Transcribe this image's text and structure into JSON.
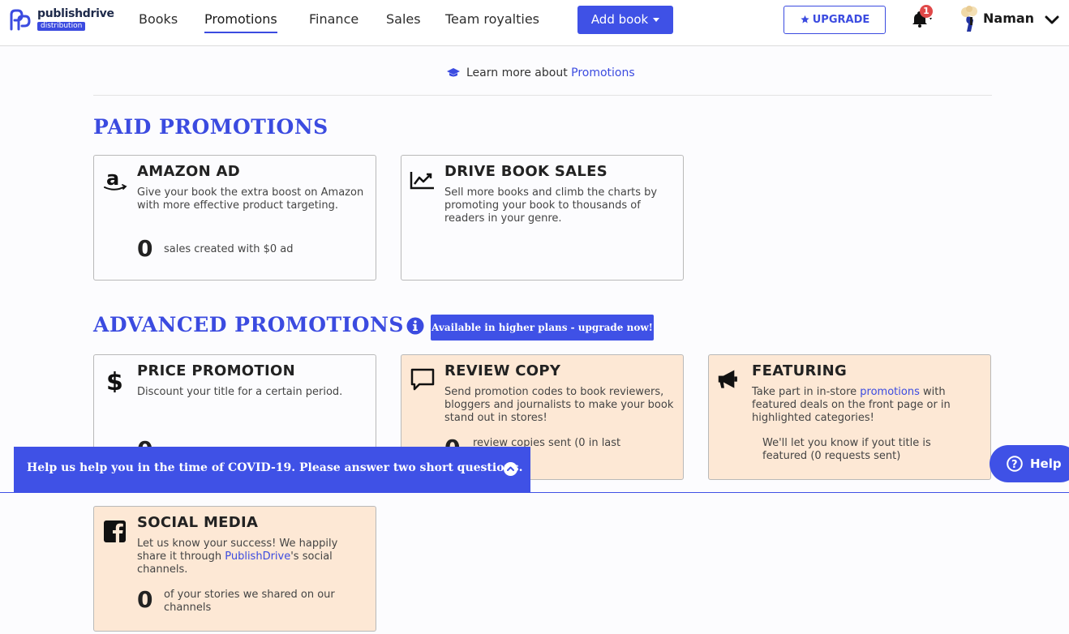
{
  "header": {
    "logo": {
      "name": "publishdrive",
      "badge": "distribution"
    },
    "nav": [
      {
        "label": "Books"
      },
      {
        "label": "Promotions",
        "active": true
      },
      {
        "label": "Finance"
      },
      {
        "label": "Sales"
      },
      {
        "label": "Team royalties"
      }
    ],
    "add_book_label": "Add book",
    "upgrade_label": "UPGRADE",
    "notification_count": "1",
    "user_name": "Naman"
  },
  "learn_more": {
    "prefix": "Learn more about",
    "link": "Promotions"
  },
  "paid": {
    "title": "PAID PROMOTIONS",
    "cards": [
      {
        "title": "AMAZON AD",
        "desc": "Give your book the extra boost on Amazon with more effective product targeting.",
        "count": "0",
        "stat": "sales created with $0 ad",
        "icon": "amazon-icon"
      },
      {
        "title": "DRIVE BOOK SALES",
        "desc": "Sell more books and climb the charts by promoting your book to thousands of readers in your genre.",
        "icon": "trending-up-icon"
      }
    ]
  },
  "advanced": {
    "title": "ADVANCED PROMOTIONS",
    "badge": "Available in higher plans - upgrade now!",
    "cards": [
      {
        "title": "PRICE PROMOTION",
        "desc": "Discount your title for a certain period.",
        "count": "0",
        "icon": "dollar-icon"
      },
      {
        "title": "REVIEW COPY",
        "desc": "Send promotion codes to book reviewers, bloggers and journalists to make your book stand out in stores!",
        "count": "0",
        "stat": "review copies sent (0 in last",
        "icon": "speech-bubble-icon"
      },
      {
        "title": "FEATURING",
        "desc_prefix": "Take part in in-store",
        "desc_link": "promotions",
        "desc_suffix": "with featured deals on the front page or in highlighted categories!",
        "stat": "We'll let you know if yout title is featured (0 requests sent)",
        "icon": "megaphone-icon"
      },
      {
        "title": "SOCIAL MEDIA",
        "desc_prefix": "Let us know your success! We happily share it through",
        "desc_link": "PublishDrive",
        "desc_suffix": "'s social channels.",
        "count": "0",
        "stat": "of your stories we shared on our channels",
        "icon": "facebook-icon"
      }
    ]
  },
  "covid_banner": {
    "text": "Help us help you in the time of COVID-19. Please answer two short questions."
  },
  "help_label": "Help",
  "colors": {
    "accent": "#3f51e6",
    "peach": "#fde8d5",
    "badge_red": "#e04848"
  }
}
